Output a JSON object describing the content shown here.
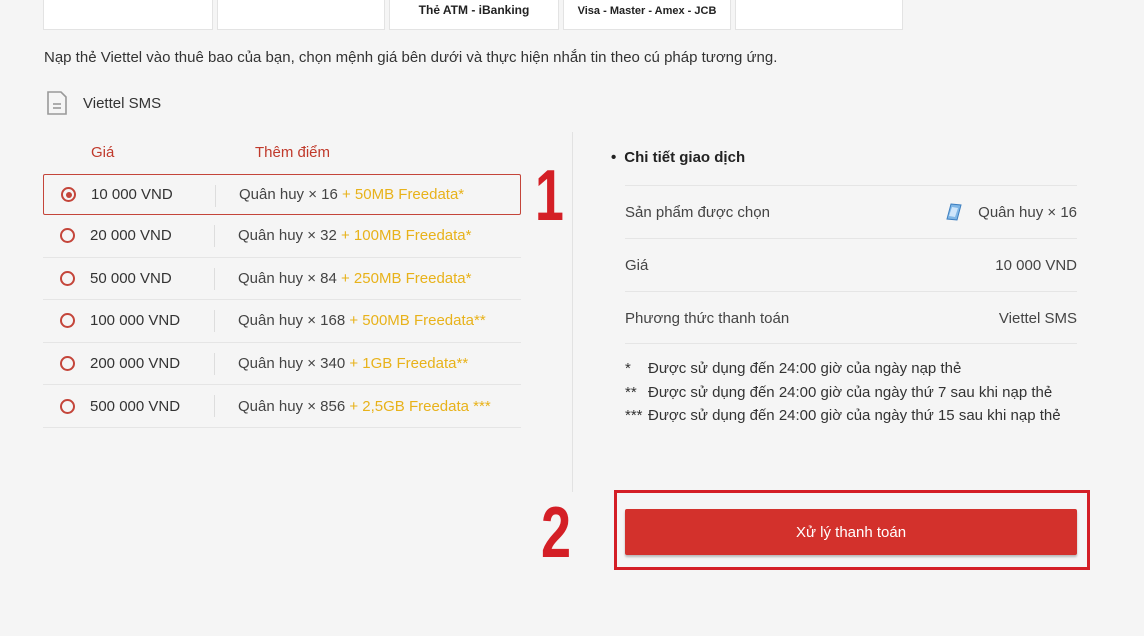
{
  "payment_methods": [
    {
      "label": ""
    },
    {
      "label": ""
    },
    {
      "label": "Thẻ ATM - iBanking"
    },
    {
      "label": "Visa - Master - Amex - JCB"
    },
    {
      "label": ""
    }
  ],
  "intro_text": "Nạp thẻ Viettel vào thuê bao của bạn, chọn mệnh giá bên dưới và thực hiện nhắn tin theo cú pháp tương ứng.",
  "method_name": "Viettel SMS",
  "table": {
    "col_price": "Giá",
    "col_points": "Thêm điểm",
    "rows": [
      {
        "price": "10 000 VND",
        "points": "Quân huy × 16",
        "bonus": " + 50MB Freedata*",
        "selected": true
      },
      {
        "price": "20 000 VND",
        "points": "Quân huy × 32",
        "bonus": " + 100MB Freedata*",
        "selected": false
      },
      {
        "price": "50 000 VND",
        "points": "Quân huy × 84",
        "bonus": " + 250MB Freedata*",
        "selected": false
      },
      {
        "price": "100 000 VND",
        "points": "Quân huy × 168",
        "bonus": " + 500MB Freedata**",
        "selected": false
      },
      {
        "price": "200 000 VND",
        "points": "Quân huy × 340",
        "bonus": " + 1GB Freedata**",
        "selected": false
      },
      {
        "price": "500 000 VND",
        "points": "Quân huy × 856",
        "bonus": " + 2,5GB Freedata ***",
        "selected": false
      }
    ]
  },
  "annotations": {
    "step1": "1",
    "step2": "2"
  },
  "detail": {
    "title": "Chi tiết giao dịch",
    "product_label": "Sản phẩm được chọn",
    "product_value": "Quân huy × 16",
    "price_label": "Giá",
    "price_value": "10 000 VND",
    "method_label": "Phương thức thanh toán",
    "method_value": "Viettel SMS"
  },
  "notes": [
    {
      "mark": "*",
      "text": "Được sử dụng đến 24:00 giờ của ngày nạp thẻ"
    },
    {
      "mark": "**",
      "text": "Được sử dụng đến 24:00 giờ của ngày thứ 7 sau khi nạp thẻ"
    },
    {
      "mark": "***",
      "text": "Được sử dụng đến 24:00 giờ của ngày thứ 15 sau khi nạp thẻ"
    }
  ],
  "pay_button": "Xử lý thanh toán",
  "colors": {
    "accent": "#d3312c",
    "bonus": "#e8b21a",
    "annotation": "#d41f26"
  },
  "icons": {
    "method": "document-icon",
    "product": "card-icon"
  }
}
